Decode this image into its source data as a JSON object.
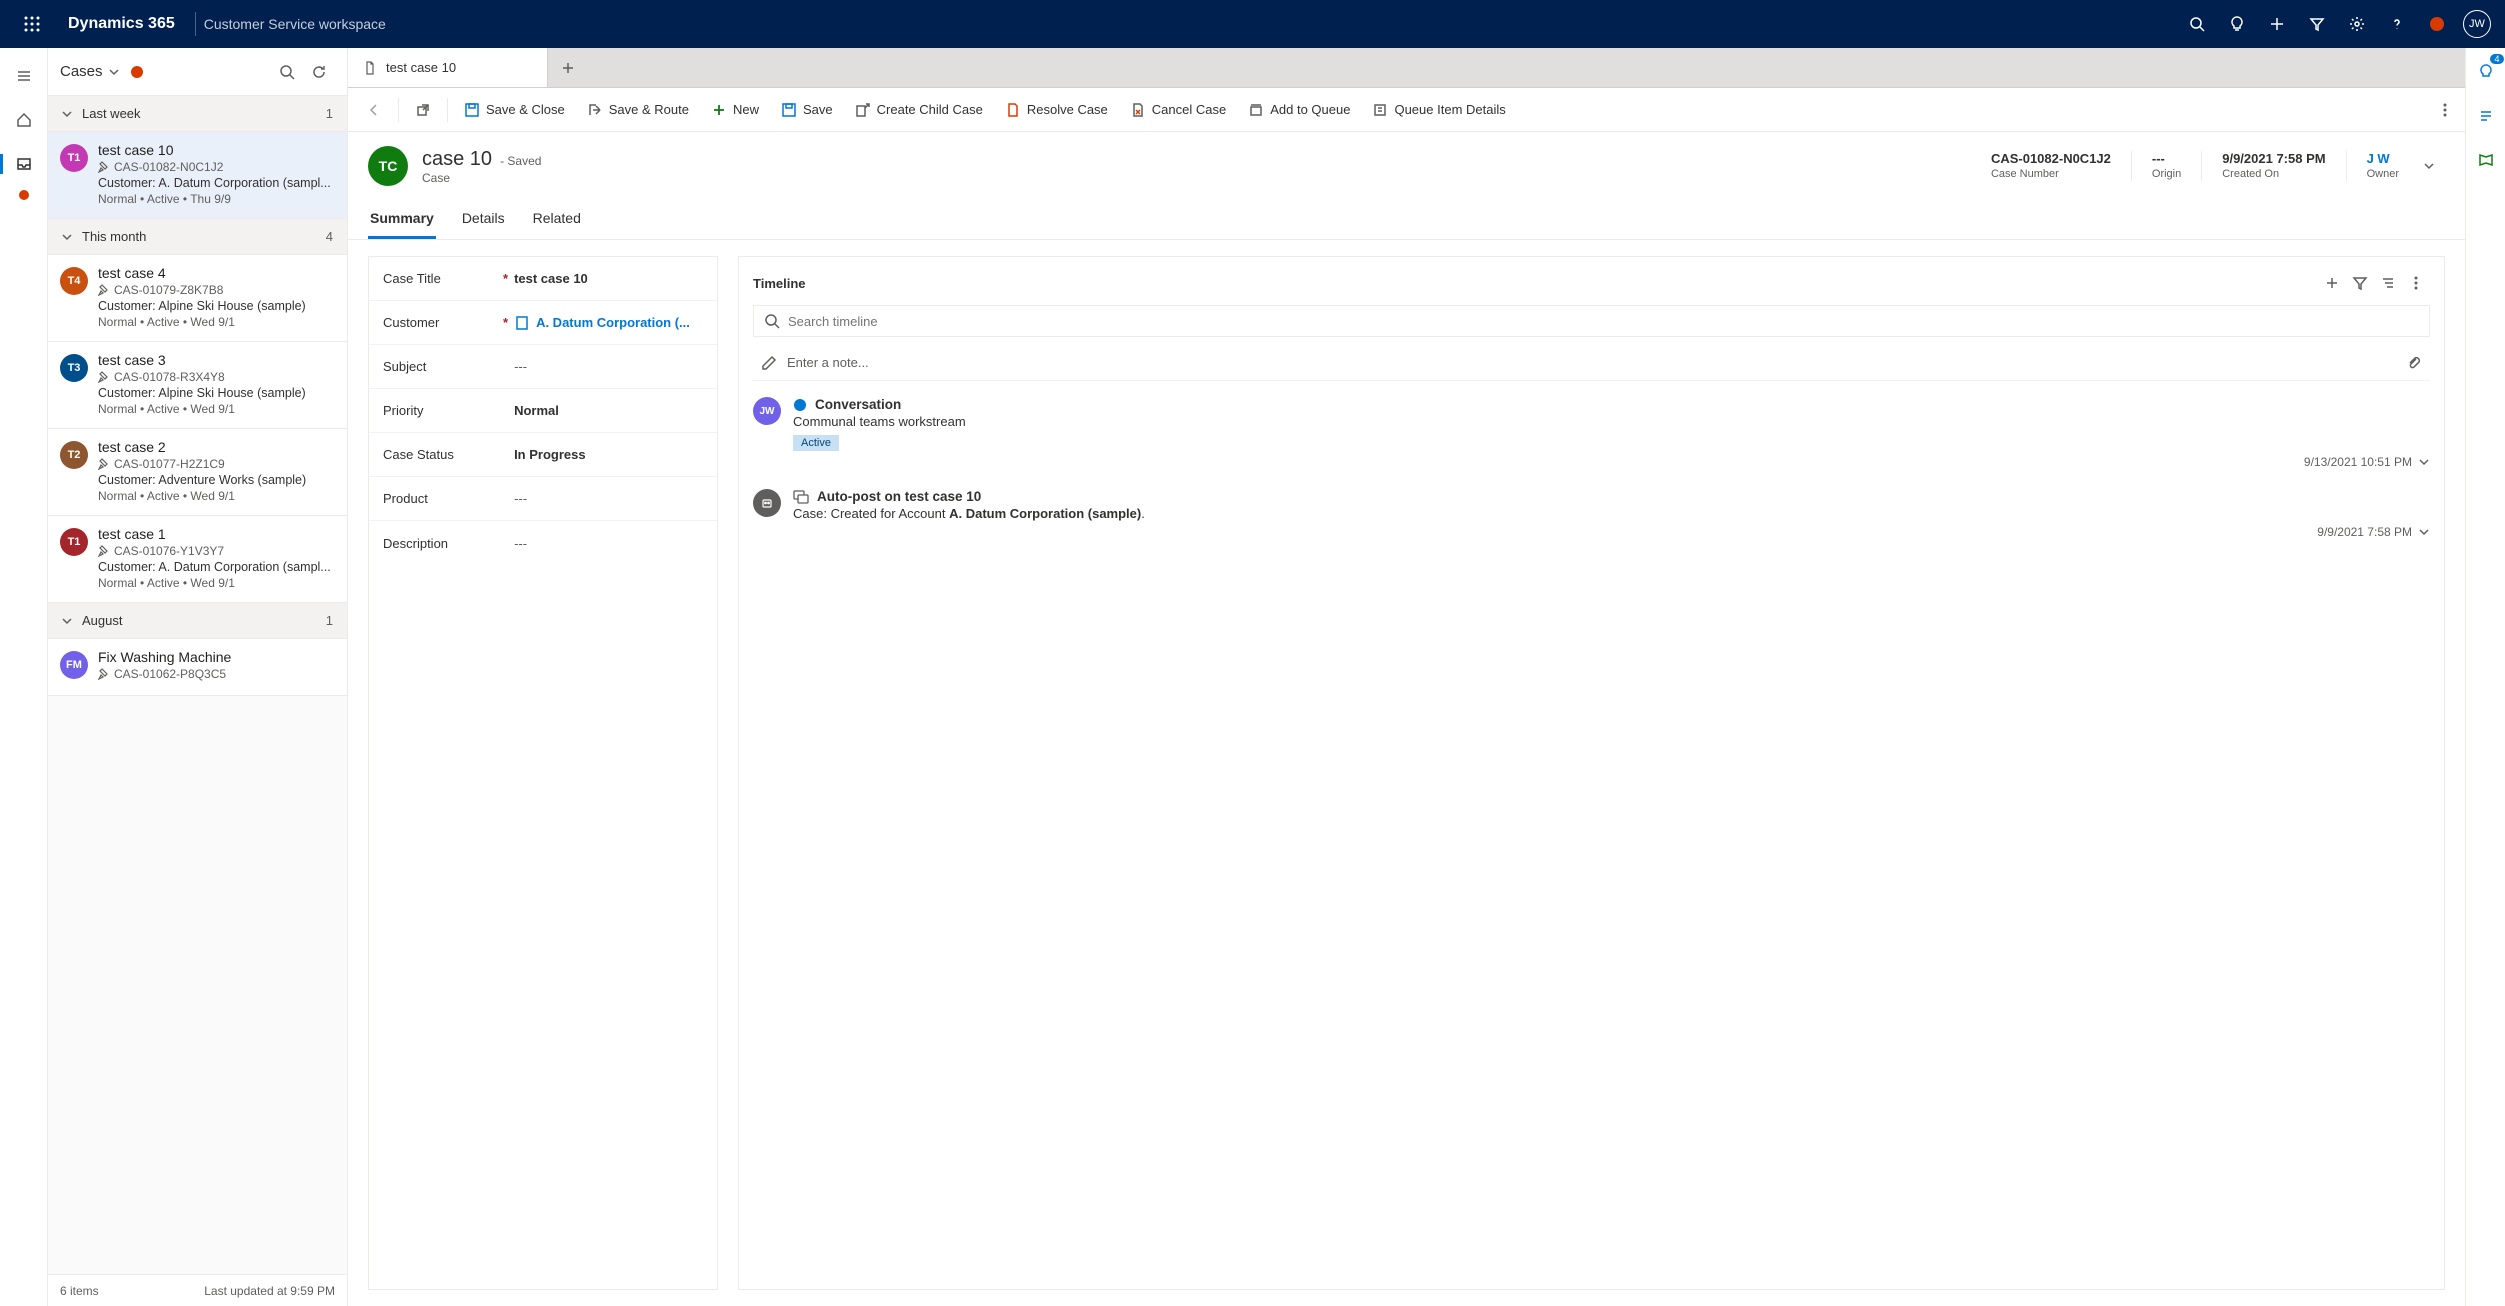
{
  "topbar": {
    "brand": "Dynamics 365",
    "workspace": "Customer Service workspace",
    "avatar_initials": "JW"
  },
  "listpane": {
    "title": "Cases",
    "groups": [
      {
        "label": "Last week",
        "count": "1"
      },
      {
        "label": "This month",
        "count": "4"
      },
      {
        "label": "August",
        "count": "1"
      }
    ],
    "items_lastweek": [
      {
        "initials": "T1",
        "color": "#c239b3",
        "title": "test case 10",
        "num": "CAS-01082-N0C1J2",
        "customer": "Customer: A. Datum Corporation (sampl...",
        "meta": "Normal • Active • Thu 9/9"
      }
    ],
    "items_month": [
      {
        "initials": "T4",
        "color": "#ca5010",
        "title": "test case 4",
        "num": "CAS-01079-Z8K7B8",
        "customer": "Customer: Alpine Ski House (sample)",
        "meta": "Normal • Active • Wed 9/1"
      },
      {
        "initials": "T3",
        "color": "#004e8c",
        "title": "test case 3",
        "num": "CAS-01078-R3X4Y8",
        "customer": "Customer: Alpine Ski House (sample)",
        "meta": "Normal • Active • Wed 9/1"
      },
      {
        "initials": "T2",
        "color": "#8e562e",
        "title": "test case 2",
        "num": "CAS-01077-H2Z1C9",
        "customer": "Customer: Adventure Works (sample)",
        "meta": "Normal • Active • Wed 9/1"
      },
      {
        "initials": "T1",
        "color": "#a4262c",
        "title": "test case 1",
        "num": "CAS-01076-Y1V3Y7",
        "customer": "Customer: A. Datum Corporation (sampl...",
        "meta": "Normal • Active • Wed 9/1"
      }
    ],
    "items_august": [
      {
        "initials": "FM",
        "color": "#7160e8",
        "title": "Fix Washing Machine",
        "num": "CAS-01062-P8Q3C5",
        "customer": "",
        "meta": ""
      }
    ],
    "footer_count": "6 items",
    "footer_updated": "Last updated at 9:59 PM"
  },
  "tab": {
    "label": "test case 10"
  },
  "commands": {
    "save_close": "Save & Close",
    "save_route": "Save & Route",
    "new": "New",
    "save": "Save",
    "create_child": "Create Child Case",
    "resolve": "Resolve Case",
    "cancel": "Cancel Case",
    "add_queue": "Add to Queue",
    "queue_details": "Queue Item Details"
  },
  "record": {
    "avatar": "TC",
    "title": "case 10",
    "saved": "- Saved",
    "subtitle": "Case",
    "fields": {
      "case_number": {
        "val": "CAS-01082-N0C1J2",
        "lbl": "Case Number"
      },
      "origin": {
        "val": "---",
        "lbl": "Origin"
      },
      "created_on": {
        "val": "9/9/2021 7:58 PM",
        "lbl": "Created On"
      },
      "owner": {
        "val": "J W",
        "lbl": "Owner"
      }
    }
  },
  "formtabs": {
    "summary": "Summary",
    "details": "Details",
    "related": "Related"
  },
  "form": {
    "case_title": {
      "label": "Case Title",
      "value": "test case 10"
    },
    "customer": {
      "label": "Customer",
      "value": "A. Datum Corporation (..."
    },
    "subject": {
      "label": "Subject",
      "value": "---"
    },
    "priority": {
      "label": "Priority",
      "value": "Normal"
    },
    "status": {
      "label": "Case Status",
      "value": "In Progress"
    },
    "product": {
      "label": "Product",
      "value": "---"
    },
    "description": {
      "label": "Description",
      "value": "---"
    }
  },
  "timeline": {
    "title": "Timeline",
    "search_placeholder": "Search timeline",
    "note_placeholder": "Enter a note...",
    "items": [
      {
        "avatar": "JW",
        "avatar_color": "#7160e8",
        "title": "Conversation",
        "subtitle": "Communal teams workstream",
        "badge": "Active",
        "date": "9/13/2021 10:51 PM"
      },
      {
        "avatar_icon": true,
        "avatar_color": "#605e5c",
        "title": "Auto-post on test case 10",
        "subtitle_prefix": "Case: Created for Account ",
        "subtitle_bold": "A. Datum Corporation (sample)",
        "subtitle_suffix": ".",
        "date": "9/9/2021 7:58 PM"
      }
    ]
  },
  "rightrail": {
    "badge": "4"
  }
}
